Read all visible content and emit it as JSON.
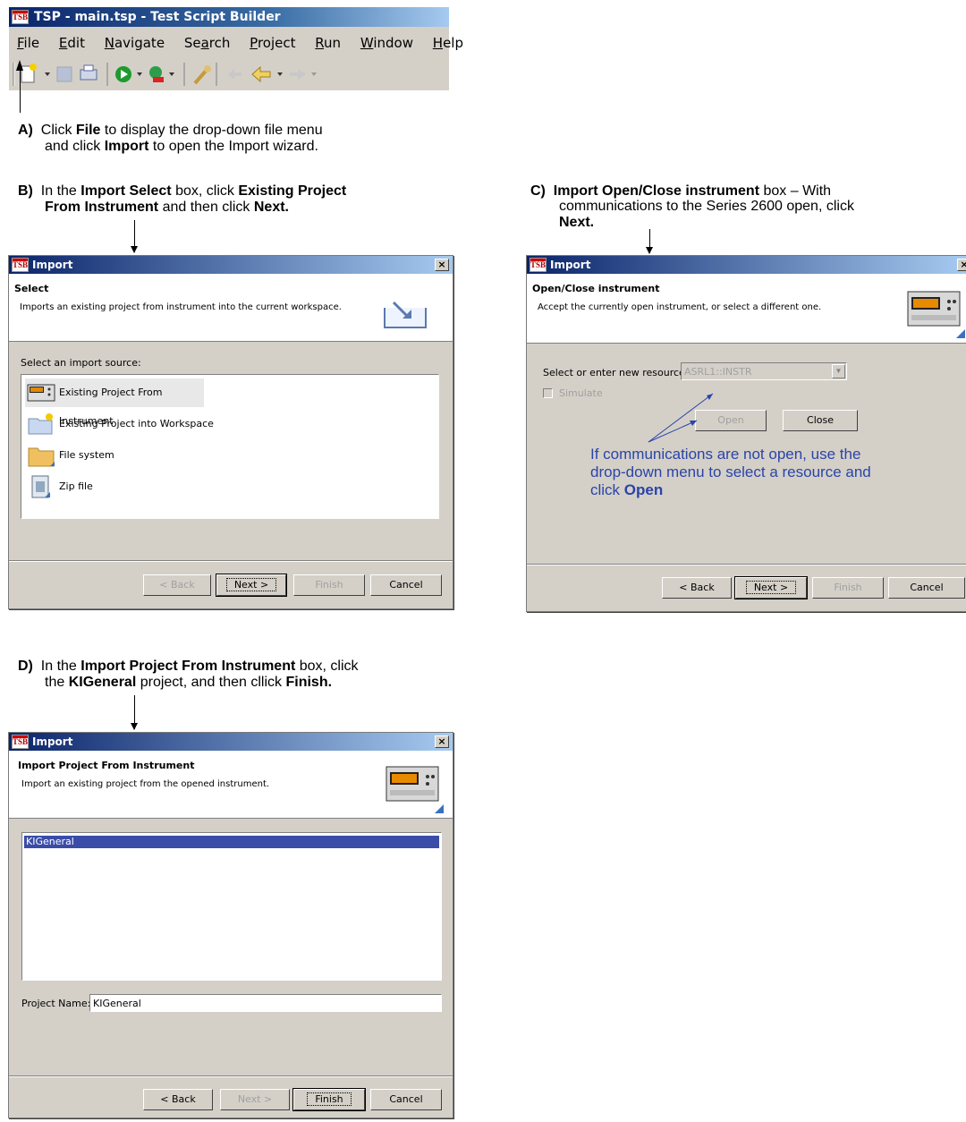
{
  "main_window": {
    "title": "TSP - main.tsp - Test Script Builder",
    "logo": "TSB",
    "menu": [
      {
        "label": "File",
        "accel": "F",
        "rest": "ile"
      },
      {
        "label": "Edit",
        "accel": "E",
        "rest": "dit"
      },
      {
        "label": "Navigate",
        "accel": "N",
        "rest": "avigate"
      },
      {
        "label": "Search",
        "pre": "Se",
        "accel": "a",
        "rest": "rch"
      },
      {
        "label": "Project",
        "accel": "P",
        "rest": "roject"
      },
      {
        "label": "Run",
        "accel": "R",
        "rest": "un"
      },
      {
        "label": "Window",
        "accel": "W",
        "rest": "indow"
      },
      {
        "label": "Help",
        "accel": "H",
        "rest": "elp"
      }
    ],
    "toolbar_icons": [
      "new-icon",
      "save-icon",
      "print-icon",
      "run-icon",
      "debug-icon",
      "search-icon",
      "back-icon",
      "forward-icon"
    ]
  },
  "steps": {
    "a": {
      "letter": "A)",
      "t1": "Click ",
      "b1": "File",
      "t2": " to display the drop-down file menu",
      "t3": "and click ",
      "b2": "Import",
      "t4": " to open the Import wizard."
    },
    "b": {
      "letter": "B)",
      "t1": "In the ",
      "b1": "Import Select",
      "t2": " box, click ",
      "b2": "Existing Project",
      "b3": "From Instrument",
      "t3": " and then click ",
      "b4": "Next."
    },
    "c": {
      "letter": "C)",
      "b1": "Import Open/Close instrument",
      "t1": " box – With",
      "t2": "communications to the Series 2600 open, click",
      "b2": "Next."
    },
    "d": {
      "letter": "D)",
      "t1": "In the ",
      "b1": "Import Project From Instrument",
      "t2": " box, click",
      "t3": "the ",
      "b2": "KIGeneral",
      "t4": " project, and then cllick ",
      "b3": "Finish."
    }
  },
  "dialog_b": {
    "title": "Import",
    "header_title": "Select",
    "header_desc": "Imports an existing project from instrument into the current workspace.",
    "source_label": "Select an import source:",
    "items": [
      "Existing Project From Instrument",
      "Existing Project into Workspace",
      "File system",
      "Zip file"
    ],
    "buttons": {
      "back": "< Back",
      "next": "Next >",
      "finish": "Finish",
      "cancel": "Cancel"
    }
  },
  "dialog_c": {
    "title": "Import",
    "header_title": "Open/Close instrument",
    "header_desc": "Accept the currently open instrument, or select a different one.",
    "resource_label": "Select or enter new resource:",
    "resource_value": "ASRL1::INSTR",
    "simulate_label": "Simulate",
    "open_label": "Open",
    "close_label": "Close",
    "callout_1": "If communications are not open, use the",
    "callout_2": "drop-down menu to select a resource and",
    "callout_3": "click ",
    "callout_bold": "Open",
    "buttons": {
      "back": "< Back",
      "next": "Next >",
      "finish": "Finish",
      "cancel": "Cancel"
    }
  },
  "dialog_d": {
    "title": "Import",
    "header_title": "Import Project From Instrument",
    "header_desc": "Import an existing project from the opened instrument.",
    "projects": [
      "KIGeneral"
    ],
    "project_name_label": "Project Name:",
    "project_name_value": "KIGeneral",
    "buttons": {
      "back": "< Back",
      "next": "Next >",
      "finish": "Finish",
      "cancel": "Cancel"
    }
  }
}
